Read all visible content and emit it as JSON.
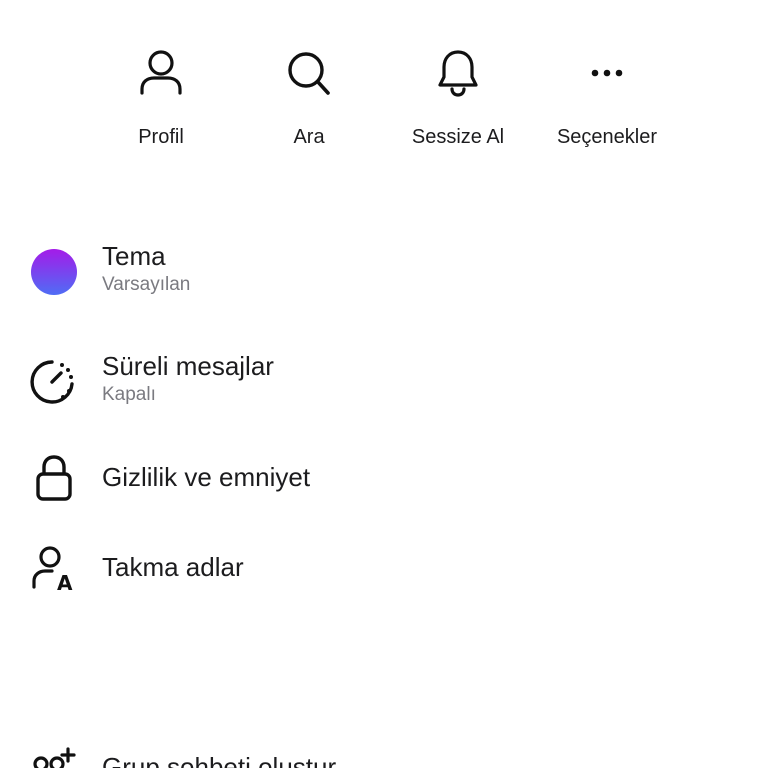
{
  "actions": [
    {
      "label": "Profil",
      "icon": "person-icon"
    },
    {
      "label": "Ara",
      "icon": "search-icon"
    },
    {
      "label": "Sessize Al",
      "icon": "bell-icon"
    },
    {
      "label": "Seçenekler",
      "icon": "more-icon"
    }
  ],
  "menu": {
    "theme": {
      "title": "Tema",
      "subtitle": "Varsayılan",
      "icon": "theme-color-icon"
    },
    "disappearing": {
      "title": "Süreli mesajlar",
      "subtitle": "Kapalı",
      "icon": "timer-icon"
    },
    "privacy": {
      "title": "Gizlilik ve emniyet",
      "icon": "lock-icon"
    },
    "nicknames": {
      "title": "Takma adlar",
      "icon": "nickname-icon"
    },
    "group": {
      "title": "Grup sohbeti oluştur",
      "icon": "add-group-icon"
    }
  },
  "colors": {
    "theme_top": "#a41be8",
    "theme_bottom": "#4f6df5",
    "text": "#1c1c1e",
    "subtext": "#7a7a80"
  }
}
